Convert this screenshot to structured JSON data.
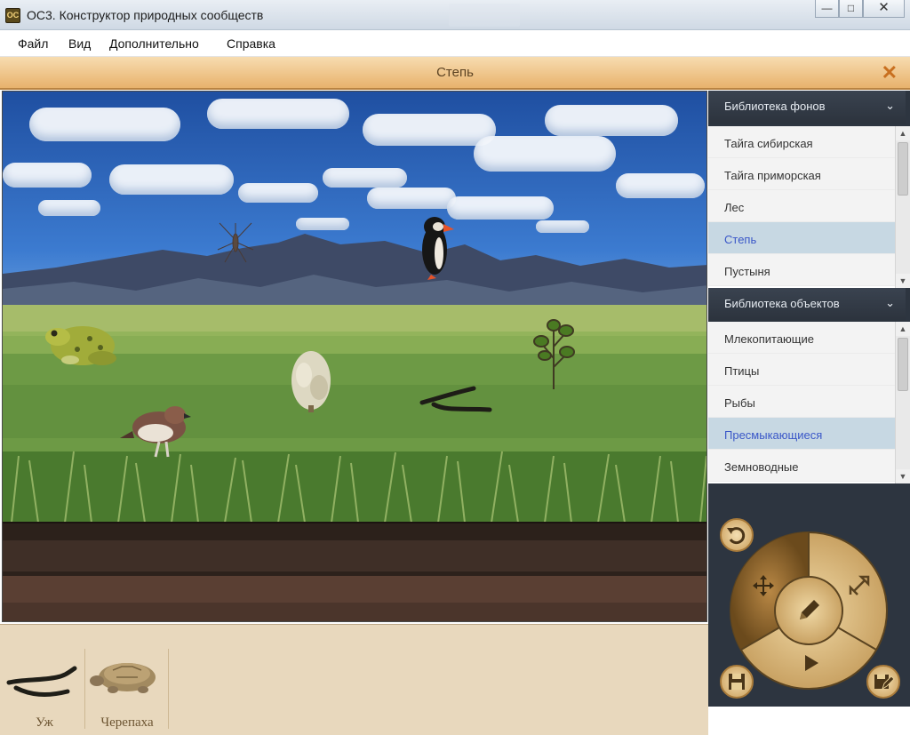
{
  "window": {
    "title": "ОС3. Конструктор природных сообществ"
  },
  "menu": {
    "items": [
      "Файл",
      "Вид",
      "Дополнительно",
      "Справка"
    ]
  },
  "scene": {
    "title": "Степь"
  },
  "backgrounds": {
    "header": "Библиотека фонов",
    "items": [
      "Тайга сибирская",
      "Тайга приморская",
      "Лес",
      "Степь",
      "Пустыня"
    ],
    "selected": "Степь"
  },
  "objects": {
    "header": "Библиотека объектов",
    "items": [
      "Млекопитающие",
      "Птицы",
      "Рыбы",
      "Пресмыкающиеся",
      "Земноводные"
    ],
    "selected": "Пресмыкающиеся"
  },
  "tray": {
    "items": [
      {
        "label": "Уж",
        "icon": "grass-snake"
      },
      {
        "label": "Черепаха",
        "icon": "tortoise"
      }
    ]
  },
  "colors": {
    "header_accent": "#e8b26c",
    "panel_dark": "#2d3540",
    "selected_text": "#3a57c8",
    "wheel_gold": "#c99d58"
  }
}
